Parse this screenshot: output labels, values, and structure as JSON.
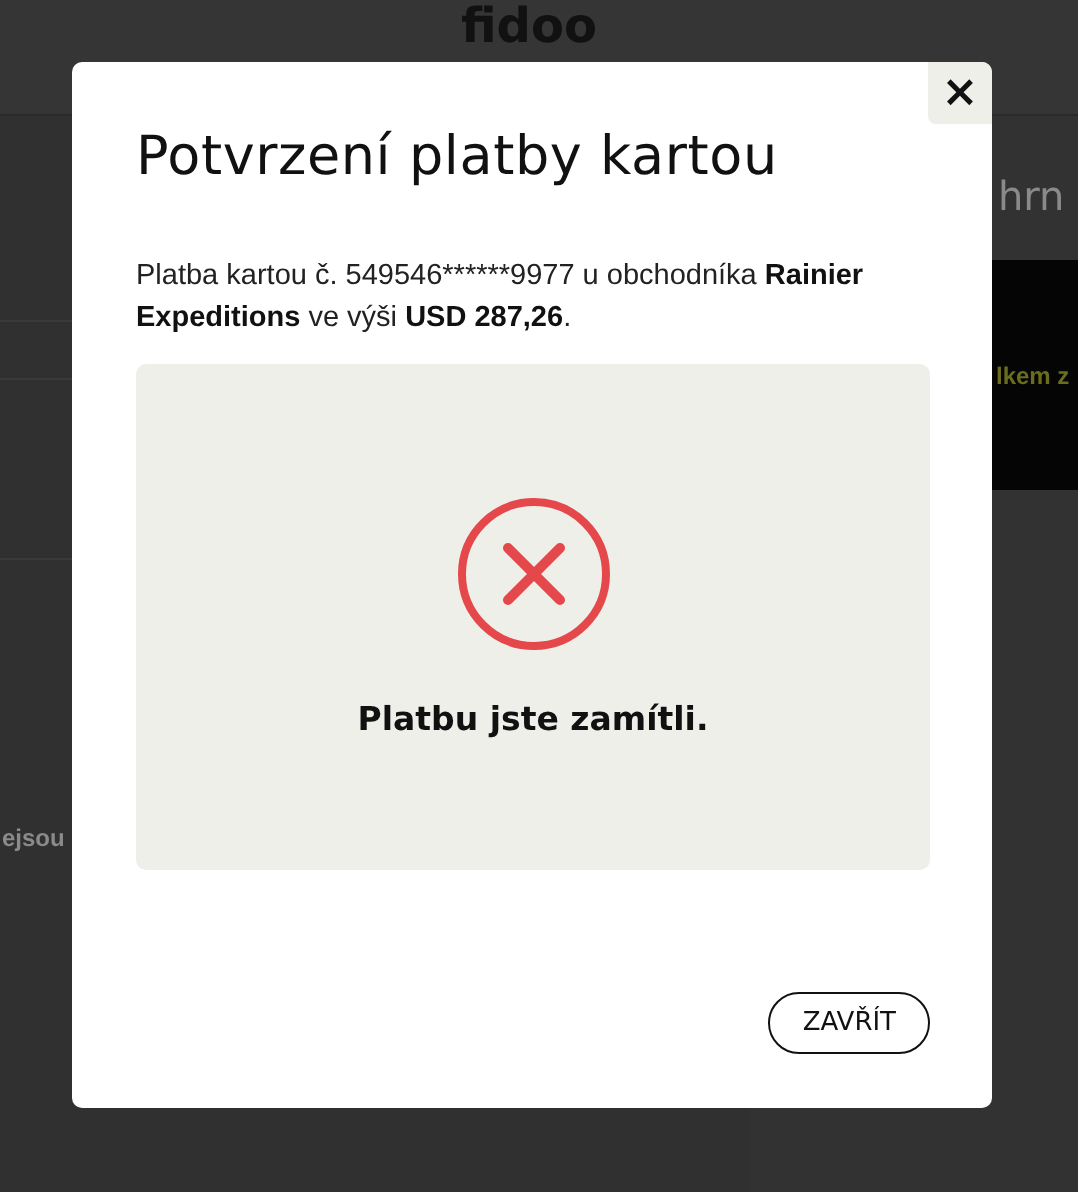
{
  "background": {
    "logo": "fidoo",
    "heading_fragment": "hrn",
    "banner_fragment": "lkem z",
    "text_fragment": "ejsou"
  },
  "dialog": {
    "close_label": "×",
    "title": "Potvrzení platby kartou",
    "message": [
      {
        "text": "Platba kartou č. 549546******9977 u obchodníka ",
        "bold": false
      },
      {
        "text": "Rainier Expeditions",
        "bold": true
      },
      {
        "text": " ve výši ",
        "bold": false
      },
      {
        "text": "USD 287,26",
        "bold": true
      },
      {
        "text": ".",
        "bold": false
      }
    ],
    "result": {
      "kind": "declined",
      "text": "Platbu jste zamítli."
    },
    "buttons": [
      "ZAVŘÍT"
    ]
  }
}
